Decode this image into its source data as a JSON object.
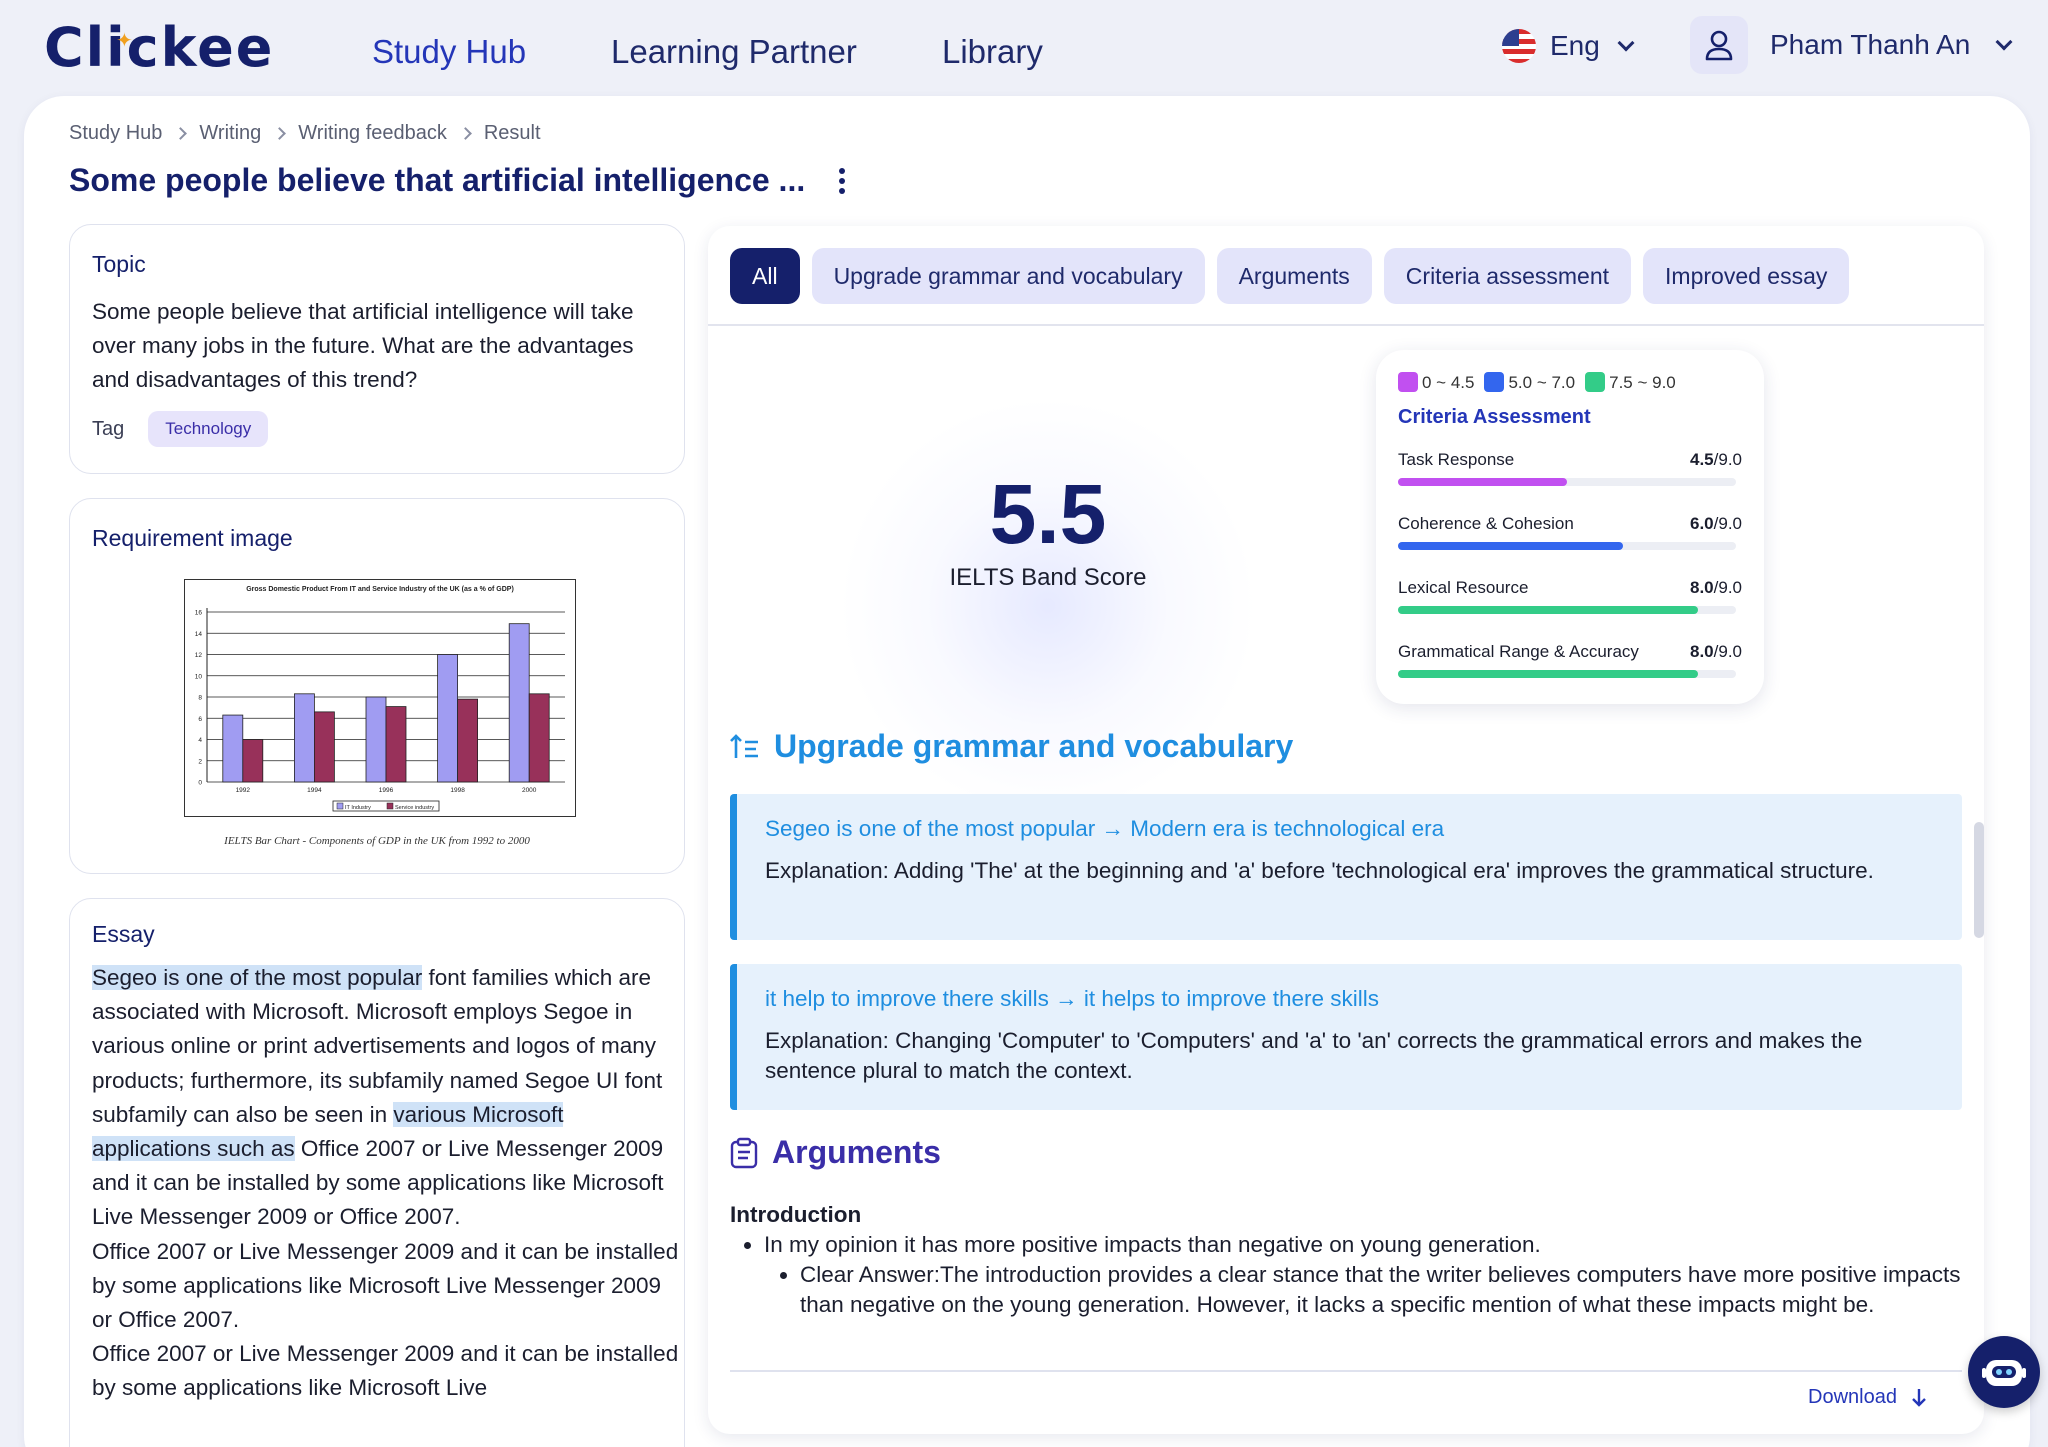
{
  "brand": {
    "logo": "Clickee"
  },
  "nav": {
    "study_hub": "Study Hub",
    "learning_partner": "Learning Partner",
    "library": "Library"
  },
  "language": {
    "label": "Eng",
    "icon": "us-flag-icon"
  },
  "user": {
    "name": "Pham Thanh An"
  },
  "breadcrumb": [
    "Study Hub",
    "Writing",
    "Writing feedback",
    "Result"
  ],
  "page_title": "Some people believe that artificial intelligence ...",
  "topic": {
    "heading": "Topic",
    "text": "Some people believe that artificial intelligence will take over many jobs in the future. What are the advantages and disadvantages of this trend?",
    "tag_label": "Tag",
    "tag": "Technology"
  },
  "requirement": {
    "heading": "Requirement image",
    "caption": "IELTS Bar Chart - Components of GDP in the UK from 1992 to 2000"
  },
  "chart_data": {
    "type": "bar",
    "title": "Gross Domestic Product From IT and Service Industry of the UK (as a % of GDP)",
    "categories": [
      "1992",
      "1994",
      "1996",
      "1998",
      "2000"
    ],
    "series": [
      {
        "name": "IT Industry",
        "values": [
          6.3,
          8.3,
          8.0,
          12.0,
          14.9
        ],
        "color": "#a09cf2"
      },
      {
        "name": "Service industry",
        "values": [
          4.0,
          6.6,
          7.1,
          7.8,
          8.3
        ],
        "color": "#98315a"
      }
    ],
    "ylim": [
      0,
      16
    ],
    "yticks": [
      "0",
      "2",
      "4",
      "6",
      "8",
      "10",
      "12",
      "14",
      "16"
    ],
    "grid": true,
    "legend": "bottom"
  },
  "essay": {
    "heading": "Essay",
    "parts": {
      "hl1": "Segeo is one of the most popular",
      "t1": " font families which are associated with Microsoft. Microsoft employs Segoe in various online or print advertisements and logos of many products; furthermore, its subfamily named Segoe UI font subfamily can also be seen in ",
      "hl2": "various Microsoft applications such as",
      "t2": " Office 2007 or Live Messenger 2009 and it can be installed by some applications like Microsoft Live Messenger 2009 or Office 2007.",
      "p2": "Office 2007 or Live Messenger 2009 and it can be installed by some applications like Microsoft Live Messenger 2009 or Office 2007.",
      "p3": "Office 2007 or Live Messenger 2009 and it can be installed by some applications like Microsoft Live"
    }
  },
  "tabs": [
    "All",
    "Upgrade grammar and vocabulary",
    "Arguments",
    "Criteria assessment",
    "Improved essay"
  ],
  "score": {
    "value": "5.5",
    "label": "IELTS Band Score"
  },
  "criteria": {
    "legend": [
      {
        "label": "0 ~ 4.5",
        "color": "#c150f0"
      },
      {
        "label": "5.0 ~ 7.0",
        "color": "#3366ee"
      },
      {
        "label": "7.5 ~ 9.0",
        "color": "#33cc88"
      }
    ],
    "title": "Criteria Assessment",
    "max": "/9.0",
    "items": [
      {
        "name": "Task Response",
        "score": "4.5",
        "fraction": 0.5,
        "color": "#c150f0"
      },
      {
        "name": "Coherence & Cohesion",
        "score": "6.0",
        "fraction": 0.6667,
        "color": "#3366ee"
      },
      {
        "name": "Lexical Resource",
        "score": "8.0",
        "fraction": 0.8889,
        "color": "#33cc88"
      },
      {
        "name": "Grammatical Range & Accuracy",
        "score": "8.0",
        "fraction": 0.8889,
        "color": "#33cc88"
      }
    ]
  },
  "grammar": {
    "heading": "Upgrade grammar and vocabulary",
    "items": [
      {
        "fix": "Segeo is one of the most popular  → Modern era is technological era",
        "explanation": "Explanation: Adding 'The' at the beginning and 'a' before 'technological era' improves the grammatical structure."
      },
      {
        "fix": "it help to improve there skills → it helps to improve there skills",
        "explanation": "Explanation: Changing 'Computer' to 'Computers' and 'a' to 'an' corrects the grammatical errors and makes the sentence plural to match the context."
      }
    ]
  },
  "arguments": {
    "heading": "Arguments",
    "intro": "Introduction",
    "point": "In my opinion it has more positive impacts than negative on young generation.",
    "sub": "Clear Answer:The introduction provides a clear stance that the writer believes computers have more positive impacts than negative on the young generation. However, it lacks a specific mention of what these impacts might be."
  },
  "download": "Download"
}
